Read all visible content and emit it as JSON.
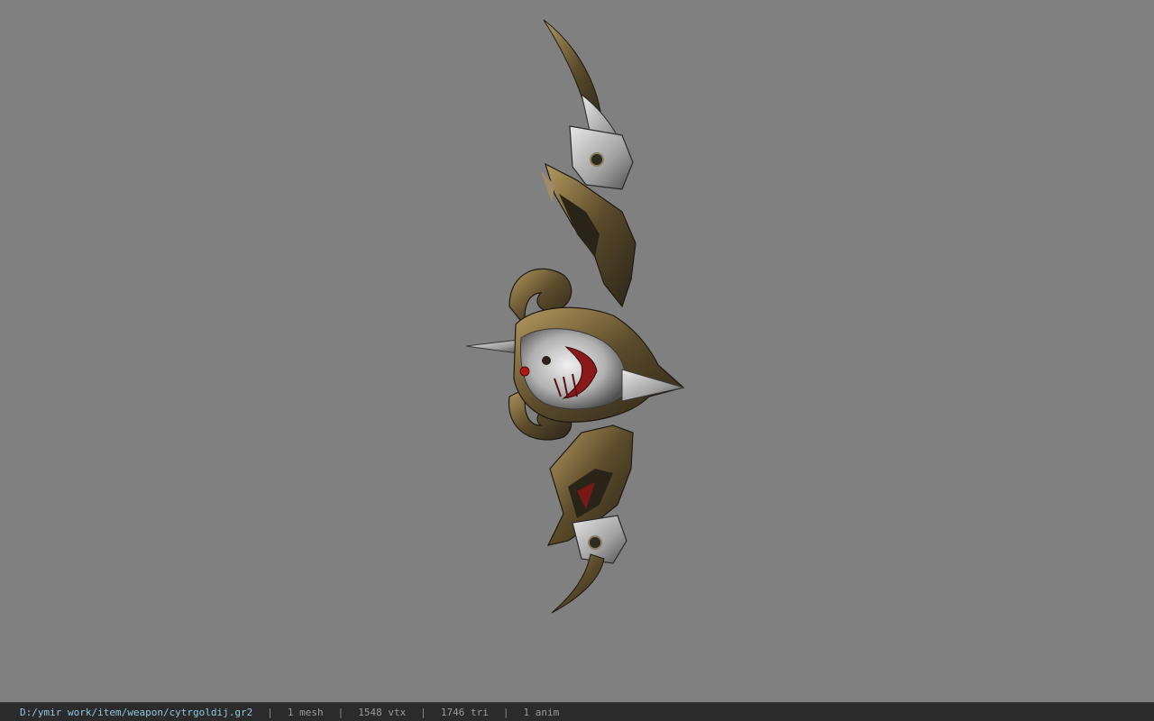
{
  "viewer": {
    "background_color": "#808080",
    "model_icon": "bow-model-icon"
  },
  "status": {
    "file_path": "D:/ymir work/item/weapon/cytrgoldij.gr2",
    "mesh_count": "1 mesh",
    "vertex_count": "1548 vtx",
    "triangle_count": "1746 tri",
    "anim_count": "1 anim",
    "separator": "|",
    "path_color": "#8fc6e0"
  }
}
